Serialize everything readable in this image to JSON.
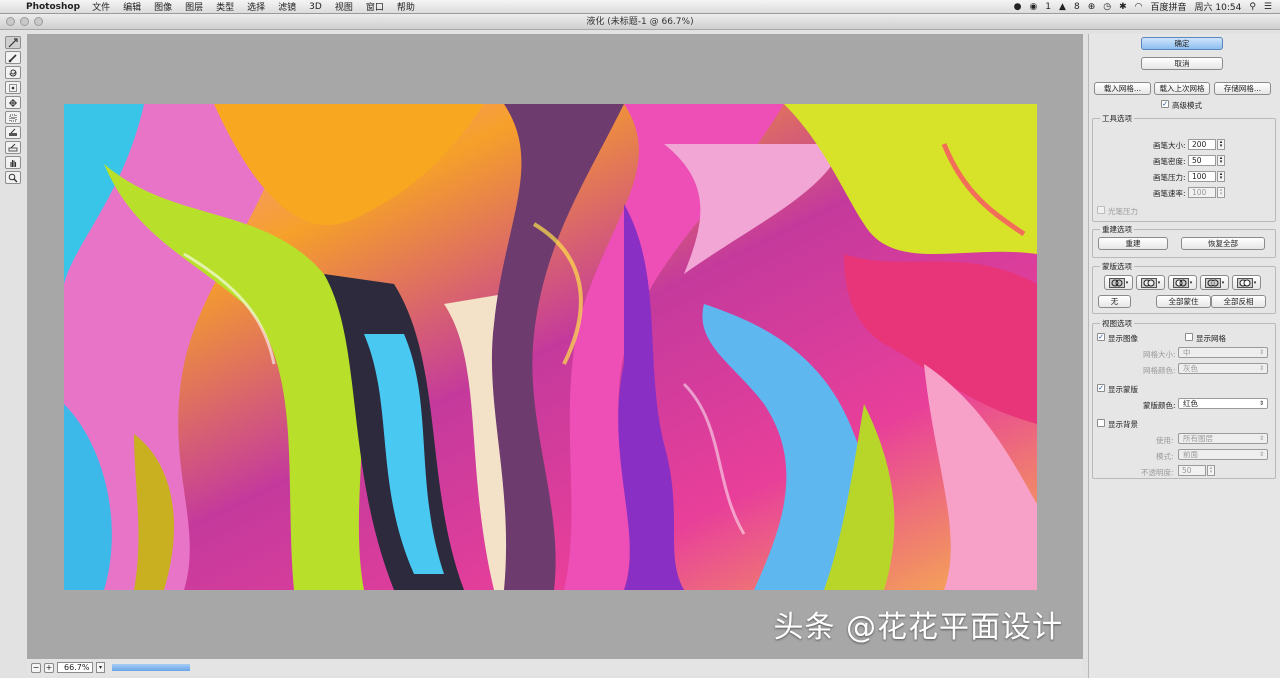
{
  "menubar": {
    "app": "Photoshop",
    "items": [
      "文件",
      "编辑",
      "图像",
      "图层",
      "类型",
      "选择",
      "滤镜",
      "3D",
      "视图",
      "窗口",
      "帮助"
    ],
    "status": {
      "badge1": "1",
      "badge2": "8",
      "ime": "百度拼音",
      "clock": "周六 10:54"
    }
  },
  "window": {
    "title": "液化 (未标题-1 @ 66.7%)"
  },
  "tools": [
    "forward-warp",
    "reconstruct",
    "twirl",
    "pucker",
    "bloat",
    "push-left",
    "freeze-mask",
    "thaw-mask",
    "hand",
    "zoom"
  ],
  "status": {
    "zoom": "66.7%"
  },
  "watermark": "头条 @花花平面设计",
  "panel": {
    "ok": "确定",
    "cancel": "取消",
    "load_mesh": "载入网格...",
    "load_last_mesh": "载入上次网格",
    "save_mesh": "存储网格...",
    "advanced_mode": "高级模式",
    "tool_options": {
      "title": "工具选项",
      "brush_size_label": "画笔大小:",
      "brush_size": "200",
      "brush_density_label": "画笔密度:",
      "brush_density": "50",
      "brush_pressure_label": "画笔压力:",
      "brush_pressure": "100",
      "brush_rate_label": "画笔速率:",
      "brush_rate": "100",
      "stylus_pressure": "光笔压力"
    },
    "reconstruct": {
      "title": "重建选项",
      "reconstruct_btn": "重建",
      "restore_all_btn": "恢复全部"
    },
    "mask": {
      "title": "蒙版选项",
      "none": "无",
      "mask_all": "全部蒙住",
      "invert_all": "全部反相"
    },
    "view": {
      "title": "视图选项",
      "show_image": "显示图像",
      "show_mesh": "显示网格",
      "mesh_size_label": "网格大小:",
      "mesh_size": "中",
      "mesh_color_label": "网格颜色:",
      "mesh_color": "灰色",
      "show_mask": "显示蒙版",
      "mask_color_label": "蒙版颜色:",
      "mask_color": "红色",
      "show_backdrop": "显示背景",
      "use_label": "使用:",
      "use": "所有图层",
      "mode_label": "模式:",
      "mode": "前面",
      "opacity_label": "不透明度:",
      "opacity": "50"
    }
  },
  "colors": {
    "accent": "#8ebdf0",
    "preview_bg": "#a7a7a7"
  }
}
